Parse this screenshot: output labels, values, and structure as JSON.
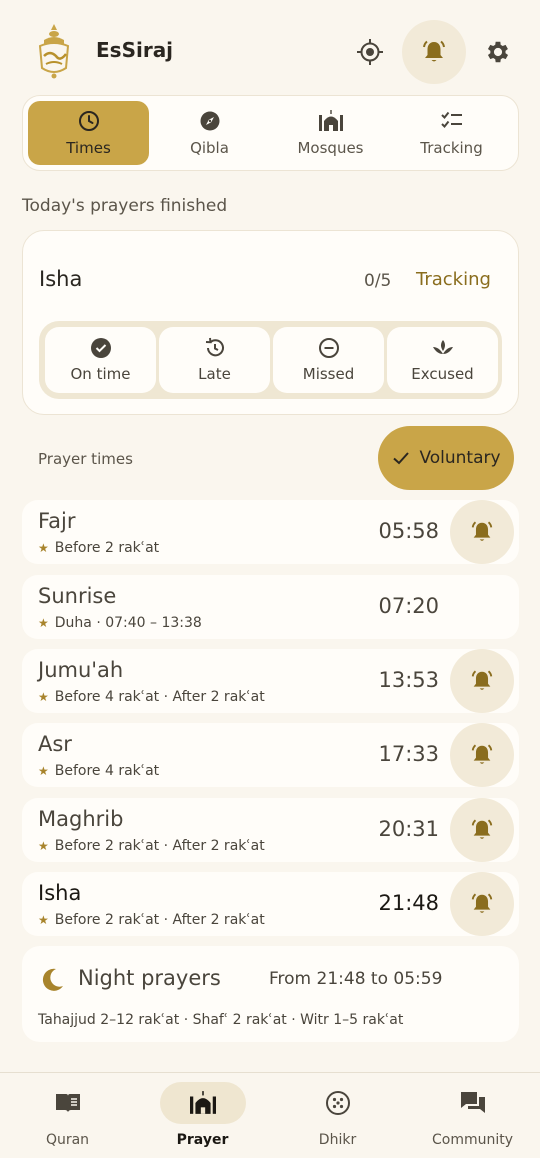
{
  "app": {
    "title": "EsSiraj"
  },
  "tabs": [
    {
      "label": "Times",
      "icon": "clock-icon",
      "active": true
    },
    {
      "label": "Qibla",
      "icon": "compass-icon",
      "active": false
    },
    {
      "label": "Mosques",
      "icon": "mosque-icon",
      "active": false
    },
    {
      "label": "Tracking",
      "icon": "checklist-icon",
      "active": false
    }
  ],
  "status_section": {
    "title": "Today's prayers finished",
    "current_prayer": "Isha",
    "count": "0/5",
    "tracking_link": "Tracking",
    "options": [
      {
        "label": "On time",
        "icon": "check-circle-icon"
      },
      {
        "label": "Late",
        "icon": "history-icon"
      },
      {
        "label": "Missed",
        "icon": "minus-circle-icon"
      },
      {
        "label": "Excused",
        "icon": "lotus-icon"
      }
    ]
  },
  "prayer_times": {
    "label": "Prayer times",
    "voluntary_label": "Voluntary",
    "rows": [
      {
        "name": "Fajr",
        "sub": "Before 2 rakʿat",
        "time": "05:58",
        "bell": true,
        "next": false
      },
      {
        "name": "Sunrise",
        "sub": "Duha · 07:40 – 13:38",
        "time": "07:20",
        "bell": false,
        "next": false
      },
      {
        "name": "Jumu'ah",
        "sub": "Before 4 rakʿat · After 2 rakʿat",
        "time": "13:53",
        "bell": true,
        "next": false
      },
      {
        "name": "Asr",
        "sub": "Before 4 rakʿat",
        "time": "17:33",
        "bell": true,
        "next": false
      },
      {
        "name": "Maghrib",
        "sub": "Before 2 rakʿat · After 2 rakʿat",
        "time": "20:31",
        "bell": true,
        "next": false
      },
      {
        "name": "Isha",
        "sub": "Before 2 rakʿat · After 2 rakʿat",
        "time": "21:48",
        "bell": true,
        "next": true
      }
    ]
  },
  "night_prayers": {
    "title": "Night prayers",
    "range": "From 21:48 to 05:59",
    "sub": "Tahajjud 2–12 rakʿat · Shafʿ 2 rakʿat · Witr 1–5 rakʿat"
  },
  "bottom_nav": [
    {
      "label": "Quran",
      "icon": "book-icon",
      "active": false
    },
    {
      "label": "Prayer",
      "icon": "mosque-icon",
      "active": true
    },
    {
      "label": "Dhikr",
      "icon": "beads-icon",
      "active": false
    },
    {
      "label": "Community",
      "icon": "chat-icon",
      "active": false
    }
  ],
  "colors": {
    "accent": "#c9a548",
    "accent_dark": "#8a6d1e",
    "background": "#faf6ee",
    "card": "#fffdf9"
  }
}
